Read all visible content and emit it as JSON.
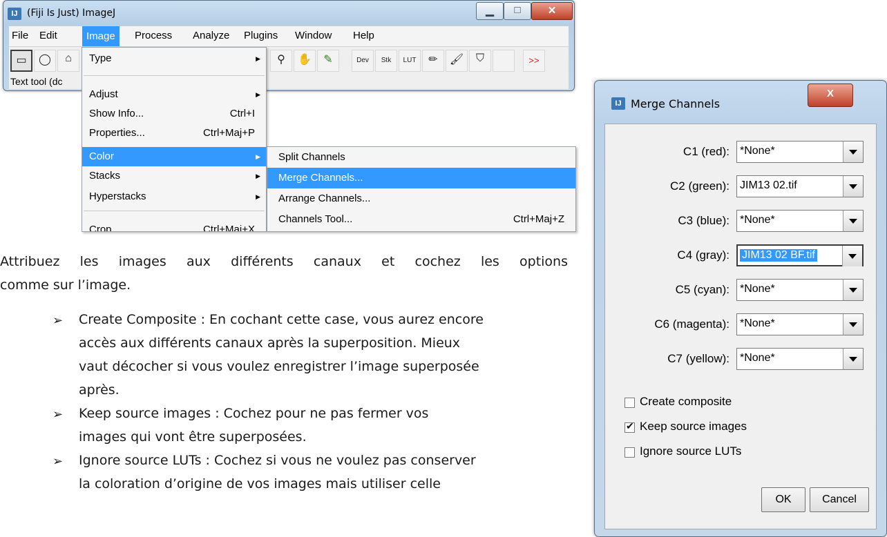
{
  "imagej_window": {
    "title": "(Fiji Is Just) ImageJ",
    "app_icon": "fiji-icon",
    "window_buttons": [
      "minimize-icon",
      "maximize-icon",
      "close-icon"
    ],
    "menubar": [
      "File",
      "Edit",
      "Image",
      "Process",
      "Analyze",
      "Plugins",
      "Window",
      "Help"
    ],
    "active_menu": "Image",
    "toolbar": {
      "tools": [
        "rectangle-tool",
        "oval-tool",
        "polygon-tool",
        "magnifier-tool",
        "hand-tool",
        "color-picker-tool",
        "dev-menu",
        "stk-menu",
        "lut-menu",
        "pencil-tool",
        "brush-tool",
        "flood-fill-tool",
        "more-tools"
      ],
      "labels": {
        "dev": "Dev",
        "stk": "Stk",
        "lut": "LUT",
        "more": ">>"
      }
    },
    "status": "Text tool (dc"
  },
  "image_menu": {
    "items": [
      {
        "label": "Type",
        "shortcut": "",
        "submenu": true
      },
      {
        "label": "Adjust",
        "shortcut": "",
        "submenu": true
      },
      {
        "label": "Show Info...",
        "shortcut": "Ctrl+I",
        "submenu": false
      },
      {
        "label": "Properties...",
        "shortcut": "Ctrl+Maj+P",
        "submenu": false
      },
      {
        "label": "Color",
        "shortcut": "",
        "submenu": true,
        "highlighted": true
      },
      {
        "label": "Stacks",
        "shortcut": "",
        "submenu": true
      },
      {
        "label": "Hyperstacks",
        "shortcut": "",
        "submenu": true
      },
      {
        "label": "Crop",
        "shortcut": "Ctrl+Maj+X",
        "submenu": false
      }
    ]
  },
  "color_menu": {
    "items": [
      {
        "label": "Split Channels",
        "shortcut": ""
      },
      {
        "label": "Merge Channels...",
        "shortcut": "",
        "highlighted": true
      },
      {
        "label": "Arrange Channels...",
        "shortcut": ""
      },
      {
        "label": "Channels Tool...",
        "shortcut": "Ctrl+Maj+Z"
      }
    ]
  },
  "document": {
    "intro": {
      "line1": "Attribuez les images aux différents canaux et cochez les options",
      "line2": "comme sur l’image."
    },
    "bullets": [
      {
        "lines": [
          "Create Composite : En cochant cette case, vous aurez encore",
          "accès aux différents canaux après la superposition. Mieux",
          "vaut décocher si vous voulez enregistrer l’image superposée",
          "après."
        ]
      },
      {
        "lines": [
          "Keep source images : Cochez pour ne pas fermer vos",
          "images qui vont être superposées."
        ]
      },
      {
        "lines": [
          "Ignore source LUTs : Cochez si vous ne voulez pas conserver",
          "la coloration d’origine de vos images mais utiliser celle"
        ]
      }
    ],
    "bullet_symbol": "➢"
  },
  "dialog": {
    "title": "Merge Channels",
    "close_glyph": "X",
    "channels": [
      {
        "label": "C1 (red):",
        "value": "*None*"
      },
      {
        "label": "C2 (green):",
        "value": "JIM13 02.tif"
      },
      {
        "label": "C3 (blue):",
        "value": "*None*"
      },
      {
        "label": "C4 (gray):",
        "value": "JIM13 02 BF.tif",
        "selected": true
      },
      {
        "label": "C5 (cyan):",
        "value": "*None*"
      },
      {
        "label": "C6 (magenta):",
        "value": "*None*"
      },
      {
        "label": "C7 (yellow):",
        "value": "*None*"
      }
    ],
    "options": [
      {
        "label": "Create composite",
        "checked": false
      },
      {
        "label": "Keep source images",
        "checked": true
      },
      {
        "label": "Ignore source LUTs",
        "checked": false
      }
    ],
    "ok_label": "OK",
    "cancel_label": "Cancel",
    "tick_glyph": "✔"
  },
  "colors": {
    "selection_blue": "#3399ff",
    "titlebar_blue": "#c8dcf0",
    "close_red": "#c0402a"
  }
}
